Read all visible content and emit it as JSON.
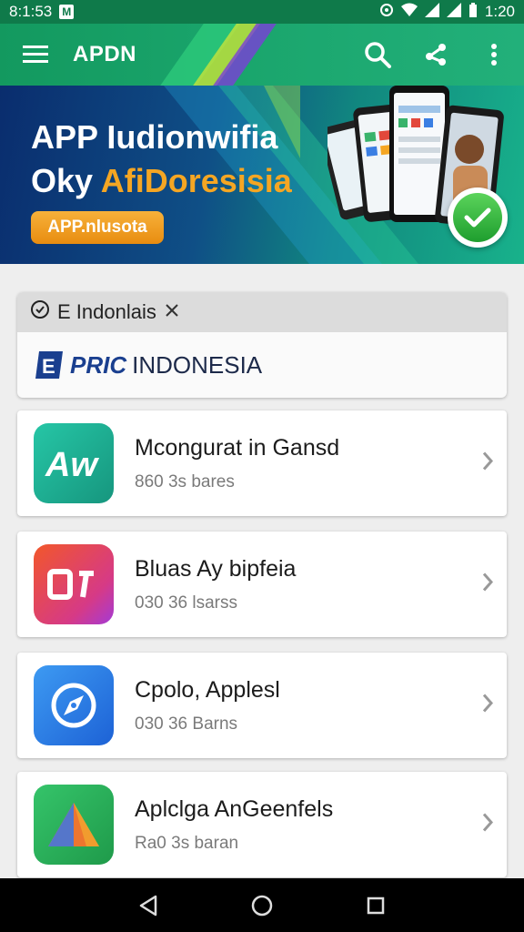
{
  "status_bar": {
    "time": "8:1:53",
    "notification_letter": "M",
    "right_time": "1:20"
  },
  "toolbar": {
    "brand": "APDN"
  },
  "banner": {
    "title_line1": "APP Iudionwifia",
    "title_line2_prefix": "Oky",
    "title_line2_accent": "AfiDoresisia",
    "cta_label": "APP.nlusota"
  },
  "search_card": {
    "header_label": "E Indonlais",
    "brand_bold": "PRIC",
    "brand_rest": "INDONESIA"
  },
  "apps": [
    {
      "name": "Mcongurat in Gansd",
      "subtitle": "860 3s bares",
      "icon": "aw-icon",
      "color": "#1fb89a"
    },
    {
      "name": "Bluas Ay bipfeia",
      "subtitle": "030 36 lsarss",
      "icon": "os-icon",
      "color": "#e8363a"
    },
    {
      "name": "Cpolo, Applesl",
      "subtitle": "030 36 Barns",
      "icon": "compass-icon",
      "color": "#2f7fe8"
    },
    {
      "name": "Aplclga AnGeenfels",
      "subtitle": "Ra0 3s baran",
      "icon": "triangle-icon",
      "color": "#2cae58"
    }
  ]
}
